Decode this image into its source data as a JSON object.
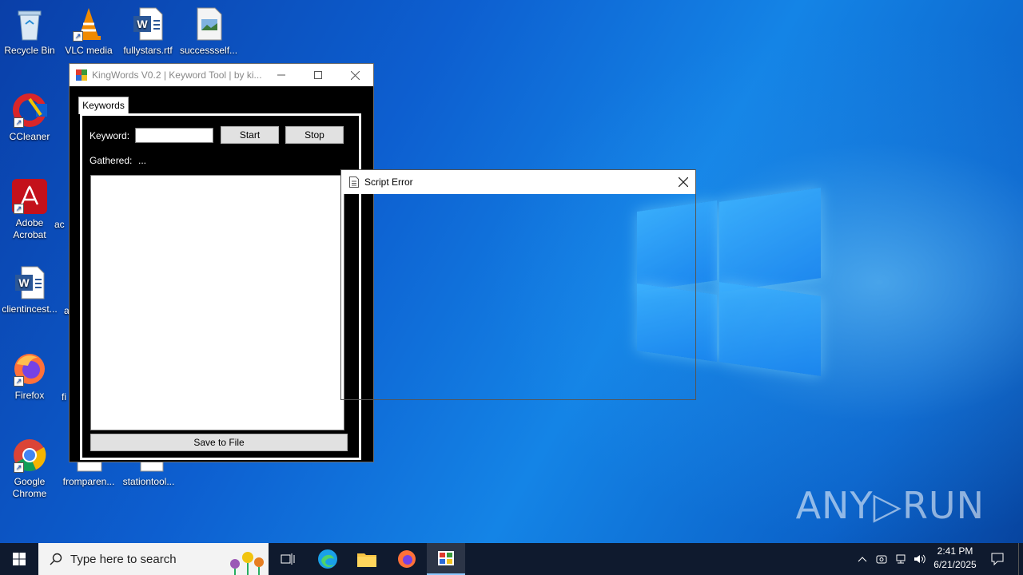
{
  "desktop": {
    "icons": [
      {
        "label": "Recycle Bin"
      },
      {
        "label": "VLC media"
      },
      {
        "label": "fullystars.rtf"
      },
      {
        "label": "successself..."
      },
      {
        "label": "CCleaner"
      },
      {
        "label": "Adobe Acrobat"
      },
      {
        "label": "clientincest..."
      },
      {
        "label": "Firefox"
      },
      {
        "label": "Google Chrome"
      },
      {
        "label": "fromparen..."
      },
      {
        "label": "stationtool..."
      }
    ],
    "partial_labels": [
      "ac",
      "a",
      "fi"
    ]
  },
  "app_window": {
    "title": "KingWords V0.2 | Keyword Tool | by ki...",
    "tab_label": "Keywords",
    "keyword_label": "Keyword:",
    "keyword_value": "",
    "start_label": "Start",
    "stop_label": "Stop",
    "gathered_label": "Gathered:",
    "gathered_value": "...",
    "save_label": "Save to File"
  },
  "dialog": {
    "title": "Script Error"
  },
  "taskbar": {
    "search_placeholder": "Type here to search",
    "time": "2:41 PM",
    "date": "6/21/2025"
  },
  "watermark": "ANY▷RUN",
  "colors": {
    "desktop_blue": "#0d5fd0",
    "taskbar": "#0f1a2e",
    "window_bg": "#000000"
  }
}
